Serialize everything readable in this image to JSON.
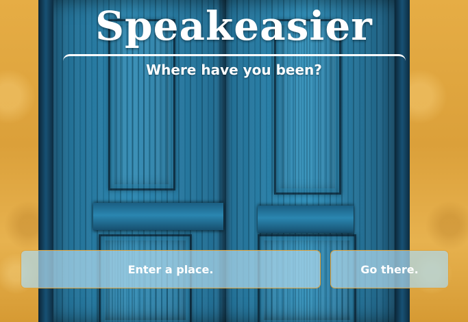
{
  "header": {
    "title": "Speakeasier",
    "subtitle": "Where have you been?"
  },
  "form": {
    "place_input": {
      "value": "",
      "placeholder": "Enter a place."
    },
    "go_button_label": "Go there."
  },
  "colors": {
    "wall": "#e2a93f",
    "door": "#1f6d93",
    "control_fill": "#add8ec",
    "control_border": "#e0a23a",
    "text": "#ffffff"
  }
}
